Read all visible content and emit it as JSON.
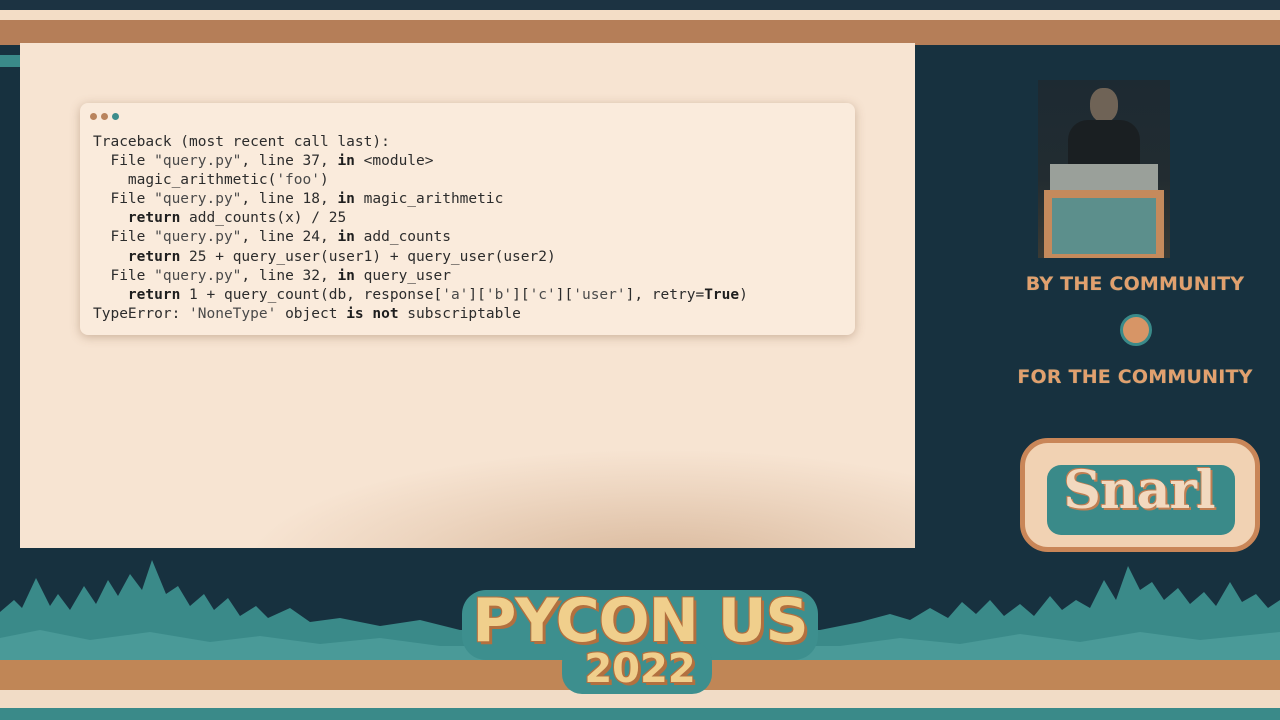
{
  "slide": {
    "code_lines": [
      [
        {
          "t": "Traceback (most recent call last):",
          "c": ""
        }
      ],
      [
        {
          "t": "  File ",
          "c": ""
        },
        {
          "t": "\"query.py\"",
          "c": "str"
        },
        {
          "t": ", line 37, ",
          "c": ""
        },
        {
          "t": "in",
          "c": "kw"
        },
        {
          "t": " <module>",
          "c": ""
        }
      ],
      [
        {
          "t": "    magic_arithmetic(",
          "c": ""
        },
        {
          "t": "'foo'",
          "c": "str"
        },
        {
          "t": ")",
          "c": ""
        }
      ],
      [
        {
          "t": "  File ",
          "c": ""
        },
        {
          "t": "\"query.py\"",
          "c": "str"
        },
        {
          "t": ", line 18, ",
          "c": ""
        },
        {
          "t": "in",
          "c": "kw"
        },
        {
          "t": " magic_arithmetic",
          "c": ""
        }
      ],
      [
        {
          "t": "    ",
          "c": ""
        },
        {
          "t": "return",
          "c": "kw"
        },
        {
          "t": " add_counts(x) / 25",
          "c": ""
        }
      ],
      [
        {
          "t": "  File ",
          "c": ""
        },
        {
          "t": "\"query.py\"",
          "c": "str"
        },
        {
          "t": ", line 24, ",
          "c": ""
        },
        {
          "t": "in",
          "c": "kw"
        },
        {
          "t": " add_counts",
          "c": ""
        }
      ],
      [
        {
          "t": "    ",
          "c": ""
        },
        {
          "t": "return",
          "c": "kw"
        },
        {
          "t": " 25 + query_user(user1) + query_user(user2)",
          "c": ""
        }
      ],
      [
        {
          "t": "  File ",
          "c": ""
        },
        {
          "t": "\"query.py\"",
          "c": "str"
        },
        {
          "t": ", line 32, ",
          "c": ""
        },
        {
          "t": "in",
          "c": "kw"
        },
        {
          "t": " query_user",
          "c": ""
        }
      ],
      [
        {
          "t": "    ",
          "c": ""
        },
        {
          "t": "return",
          "c": "kw"
        },
        {
          "t": " 1 + query_count(db, response[",
          "c": ""
        },
        {
          "t": "'a'",
          "c": "str"
        },
        {
          "t": "][",
          "c": ""
        },
        {
          "t": "'b'",
          "c": "str"
        },
        {
          "t": "][",
          "c": ""
        },
        {
          "t": "'c'",
          "c": "str"
        },
        {
          "t": "][",
          "c": ""
        },
        {
          "t": "'user'",
          "c": "str"
        },
        {
          "t": "], retry=",
          "c": ""
        },
        {
          "t": "True",
          "c": "kw"
        },
        {
          "t": ")",
          "c": ""
        }
      ],
      [
        {
          "t": "TypeError: ",
          "c": ""
        },
        {
          "t": "'NoneType'",
          "c": "str"
        },
        {
          "t": " object ",
          "c": ""
        },
        {
          "t": "is not",
          "c": "kw"
        },
        {
          "t": " subscriptable",
          "c": ""
        }
      ]
    ]
  },
  "sidebar": {
    "tagline_top": "BY THE COMMUNITY",
    "tagline_bottom": "FOR THE COMMUNITY",
    "badge_word": "Snarl"
  },
  "event": {
    "name": "PYCON US",
    "year": "2022"
  },
  "colors": {
    "slide_bg": "#f7e4d2",
    "accent_orange": "#c08656",
    "accent_teal": "#3a8a89",
    "dark_bg": "#17313f"
  }
}
